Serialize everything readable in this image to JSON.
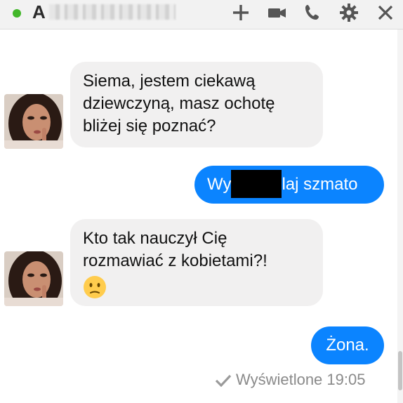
{
  "header": {
    "contact_initial": "A",
    "icons": [
      "add-people-icon",
      "video-call-icon",
      "phone-icon",
      "gear-icon",
      "close-icon"
    ],
    "status_color": "#42b72a"
  },
  "messages": [
    {
      "direction": "incoming",
      "lines": [
        "Siema, jestem ciekawą",
        "dziewczyną, masz ochotę",
        "bliżej się poznać?"
      ]
    },
    {
      "direction": "outgoing",
      "before": "Wy",
      "after": "laj szmato"
    },
    {
      "direction": "incoming",
      "lines": [
        "Kto tak nauczył Cię",
        "rozmawiać z kobietami?!"
      ],
      "emoji": "confused-face-icon"
    },
    {
      "direction": "outgoing",
      "text": "Żona."
    }
  ],
  "receipt": {
    "label": "Wyświetlone 19:05"
  },
  "colors": {
    "outgoing_bubble": "#0b84ff",
    "incoming_bubble": "#f1f0f0",
    "header_bg": "#f2f2f2"
  }
}
